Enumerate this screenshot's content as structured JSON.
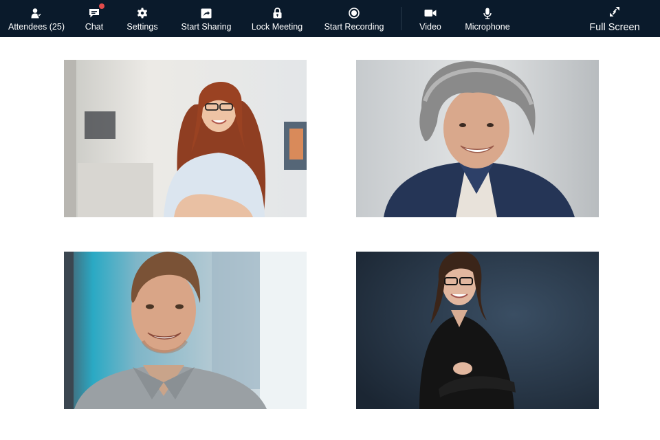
{
  "toolbar": {
    "background": "#0a1a2b",
    "items": [
      {
        "label": "Attendees (25)",
        "icon": "attendees-icon"
      },
      {
        "label": "Chat",
        "icon": "chat-icon",
        "badge_color": "#e24b4b"
      },
      {
        "label": "Settings",
        "icon": "gear-icon"
      },
      {
        "label": "Start Sharing",
        "icon": "share-screen-icon"
      },
      {
        "label": "Lock Meeting",
        "icon": "lock-icon"
      },
      {
        "label": "Start Recording",
        "icon": "record-icon"
      },
      {
        "label": "Video",
        "icon": "video-camera-icon"
      },
      {
        "label": "Microphone",
        "icon": "microphone-icon"
      }
    ],
    "fullscreen": {
      "label": "Full Screen",
      "icon": "expand-icon"
    }
  },
  "participants": [
    {
      "video": "woman-red-hair-glasses-office"
    },
    {
      "video": "older-woman-gray-curly-hair"
    },
    {
      "video": "man-gray-polo-smiling"
    },
    {
      "video": "woman-dark-hair-glasses-black-shirt"
    }
  ]
}
